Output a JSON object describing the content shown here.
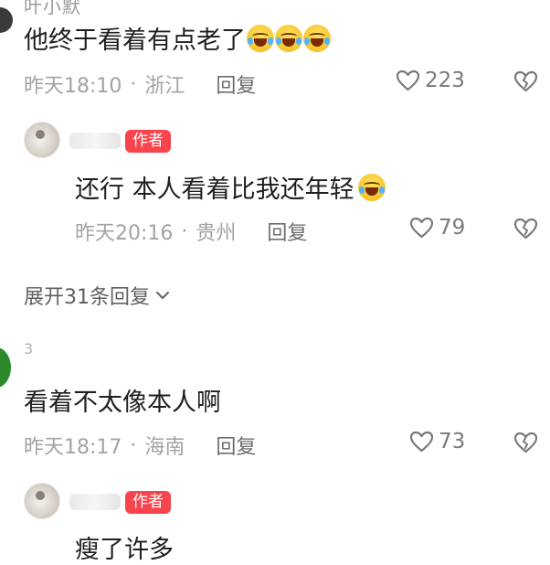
{
  "thread1": {
    "cut_name": "叶小默",
    "comment": {
      "text": "他终于看着有点老了",
      "emojis": [
        "laugh-cry-emoji",
        "laugh-cry-emoji",
        "laugh-cry-emoji"
      ],
      "time": "昨天18:10",
      "location": "浙江",
      "reply_label": "回复",
      "likes": "223"
    },
    "author_reply": {
      "badge": "作者",
      "text": "还行 本人看着比我还年轻",
      "emoji": "laugh-cry-emoji",
      "time": "昨天20:16",
      "location": "贵州",
      "reply_label": "回复",
      "likes": "79"
    },
    "expand_label": "展开31条回复"
  },
  "thread2": {
    "cut_name": "3",
    "comment": {
      "text": "看着不太像本人啊",
      "time": "昨天18:17",
      "location": "海南",
      "reply_label": "回复",
      "likes": "73"
    },
    "author_reply": {
      "badge": "作者",
      "text": "瘦了许多"
    }
  },
  "separator": "·",
  "colors": {
    "badge": "#f8444c",
    "meta": "#a3a3a3",
    "text": "#1f1f1f"
  },
  "icons": {
    "like": "heart-outline-icon",
    "dislike": "broken-heart-icon",
    "expand": "chevron-down-icon"
  }
}
